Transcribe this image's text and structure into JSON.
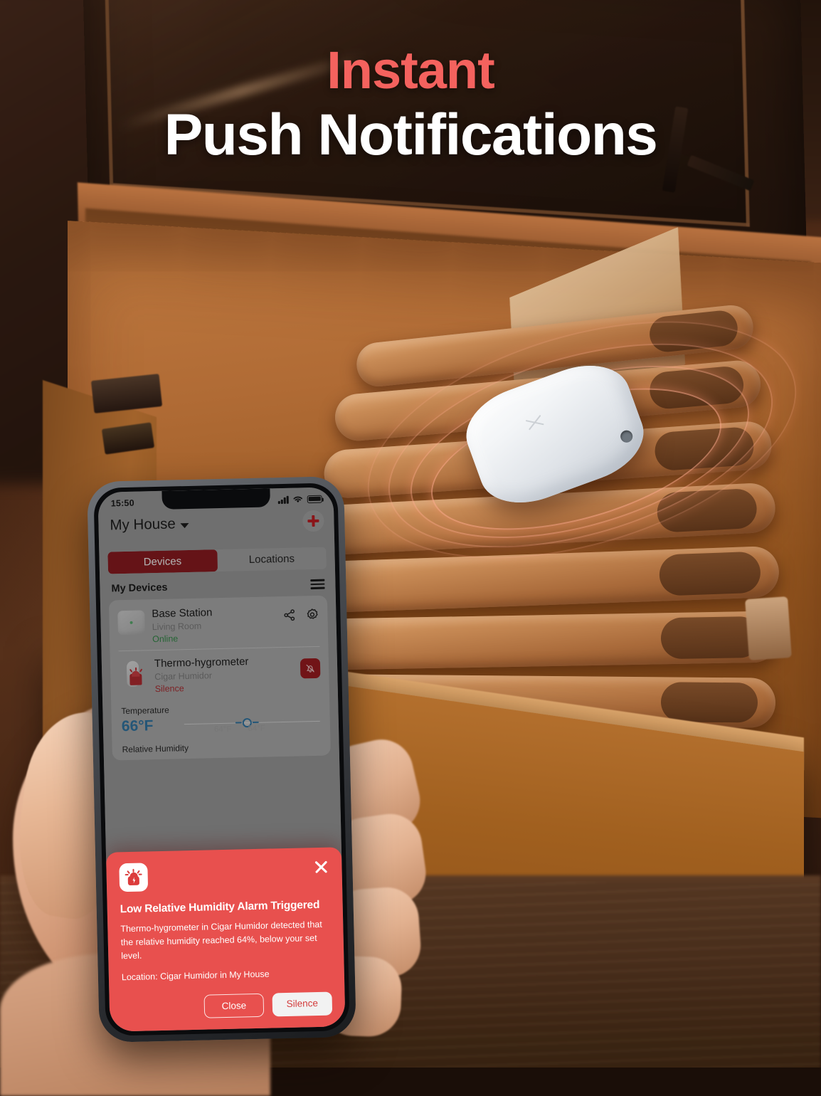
{
  "headline": {
    "line1": "Instant",
    "line2": "Push Notifications",
    "accent_color": "#f4625e",
    "text_color": "#ffffff"
  },
  "phone": {
    "status_bar": {
      "time": "15:50",
      "signal_icon": "cellular-bars-icon",
      "wifi_icon": "wifi-icon",
      "battery_icon": "battery-icon"
    },
    "app": {
      "header": {
        "house_name": "My House",
        "dropdown_icon": "chevron-down-icon",
        "add_icon": "plus-icon"
      },
      "tabs": [
        {
          "label": "Devices",
          "active": true
        },
        {
          "label": "Locations",
          "active": false
        }
      ],
      "section": {
        "title": "My Devices",
        "menu_icon": "hamburger-icon"
      },
      "devices": [
        {
          "name": "Base Station",
          "location": "Living Room",
          "status": "Online",
          "status_color": "#2e8b44",
          "share_icon": "share-icon",
          "settings_icon": "gear-icon"
        },
        {
          "name": "Thermo-hygrometer",
          "location": "Cigar Humidor",
          "status": "Silence",
          "status_color": "#b1272c",
          "action_icon": "bell-slash-icon"
        }
      ],
      "metrics": [
        {
          "label": "Temperature",
          "value": "66°F",
          "value_color": "#2c76a8",
          "range_low": "64°F",
          "range_high": "64°F"
        },
        {
          "label": "Relative Humidity"
        }
      ]
    },
    "alert": {
      "icon": "alarm-siren-icon",
      "close_icon": "close-icon",
      "background_color": "#e8504e",
      "title": "Low Relative Humidity Alarm Triggered",
      "body": "Thermo-hygrometer in Cigar Humidor detected that the relative humidity reached 64%, below your set level.",
      "location": "Location: Cigar Humidor in My House",
      "buttons": [
        {
          "label": "Close",
          "style": "outline"
        },
        {
          "label": "Silence",
          "style": "solid"
        }
      ]
    }
  }
}
